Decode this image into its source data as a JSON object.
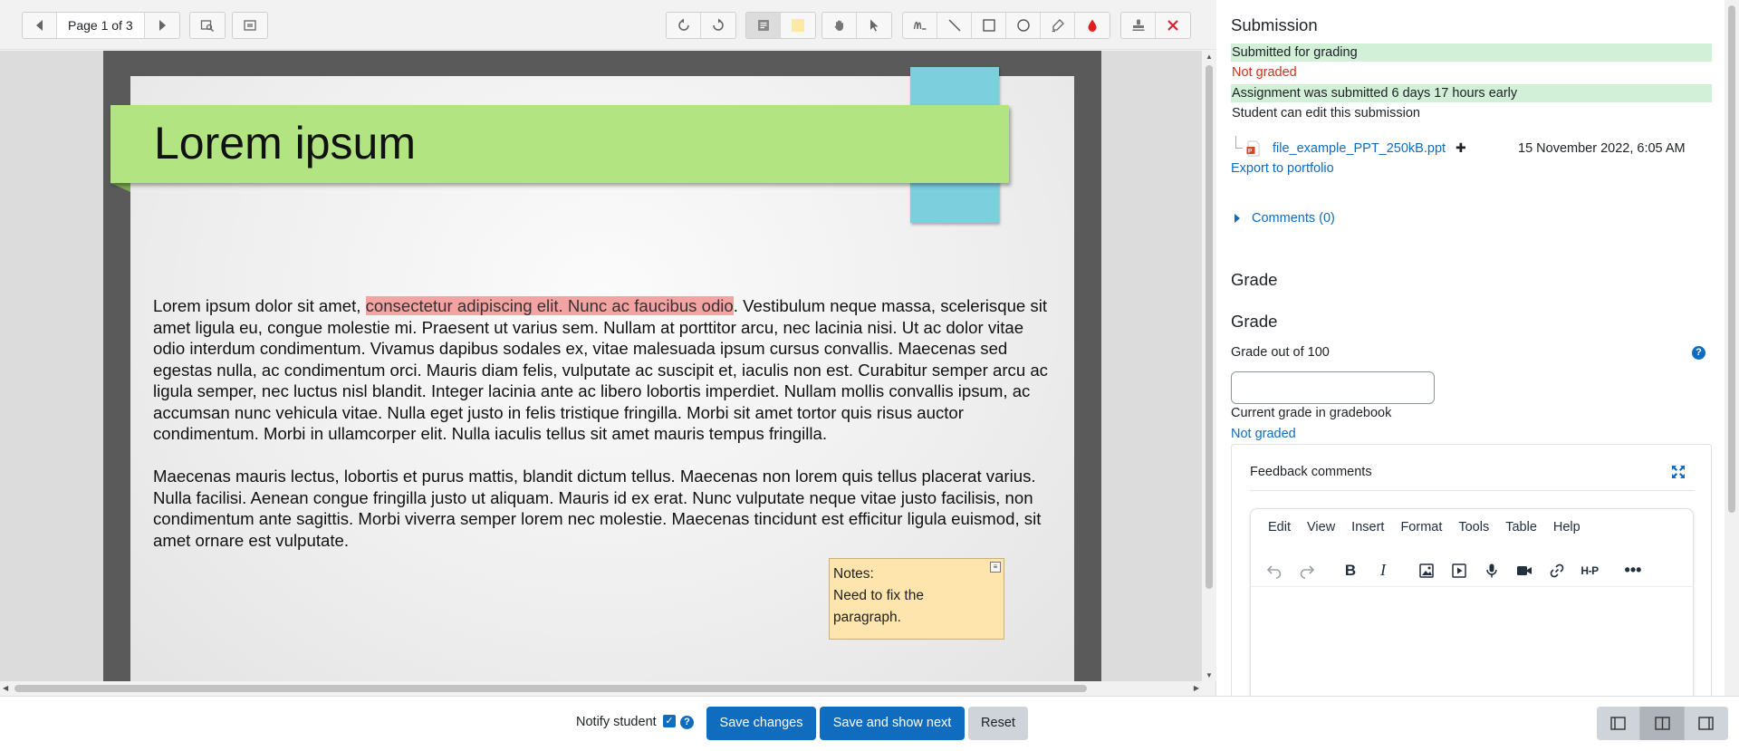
{
  "toolbar": {
    "page_label": "Page 1 of 3"
  },
  "slide": {
    "title": "Lorem ipsum",
    "p1_before": "Lorem ipsum dolor sit amet, ",
    "p1_highlight": "consectetur adipiscing elit. Nunc ac faucibus odio",
    "p1_after": ". Vestibulum neque massa, scelerisque sit amet ligula eu, congue molestie mi. Praesent ut varius sem. Nullam at porttitor arcu, nec lacinia nisi. Ut ac dolor vitae odio interdum condimentum. Vivamus dapibus sodales ex, vitae malesuada ipsum cursus convallis. Maecenas sed egestas nulla, ac condimentum orci. Mauris diam felis, vulputate ac suscipit et, iaculis non est. Curabitur semper arcu ac ligula semper, nec luctus nisl blandit. Integer lacinia ante ac libero lobortis imperdiet. Nullam mollis convallis ipsum, ac accumsan nunc vehicula vitae. Nulla eget justo in felis tristique fringilla. Morbi sit amet tortor quis risus auctor condimentum. Morbi in ullamcorper elit. Nulla iaculis tellus sit amet mauris tempus fringilla.",
    "p2": "Maecenas mauris lectus, lobortis et purus mattis, blandit dictum tellus. Maecenas non lorem quis tellus placerat varius. Nulla facilisi. Aenean congue fringilla justo ut aliquam. Mauris id ex erat. Nunc vulputate neque vitae justo facilisis, non condimentum ante sagittis. Morbi viverra semper lorem nec molestie. Maecenas tincidunt est efficitur ligula euismod, sit amet ornare est vulputate."
  },
  "sticky_note": {
    "line1": "Notes:",
    "line2": "Need to fix the",
    "line3": "paragraph."
  },
  "panel": {
    "submission_heading": "Submission",
    "status_submitted": "Submitted for grading",
    "status_grade": "Not graded",
    "status_early": "Assignment was submitted 6 days 17 hours early",
    "status_edit": "Student can edit this submission",
    "file_name": "file_example_PPT_250kB.ppt",
    "file_plus": "✚",
    "file_date": "15 November 2022, 6:05 AM",
    "export_link": "Export to portfolio",
    "comments_link": "Comments (0)",
    "grade_heading_1": "Grade",
    "grade_heading_2": "Grade",
    "grade_out_of": "Grade out of 100",
    "grade_value": "",
    "current_grade_label": "Current grade in gradebook",
    "current_grade_value": "Not graded",
    "feedback_title": "Feedback comments",
    "menu": [
      "Edit",
      "View",
      "Insert",
      "Format",
      "Tools",
      "Table",
      "Help"
    ],
    "h5p_label": "H-P"
  },
  "bottom": {
    "notify_label": "Notify student",
    "save_changes": "Save changes",
    "save_next": "Save and show next",
    "reset": "Reset"
  },
  "colors": {
    "primary": "#0f6cbf",
    "status_green": "#d2f0d8",
    "status_red": "#ca3120",
    "title_band": "#b3e482",
    "blue_tab": "#7ccfdc",
    "highlight": "#f4a3a3",
    "sticky": "#fde5ad"
  }
}
